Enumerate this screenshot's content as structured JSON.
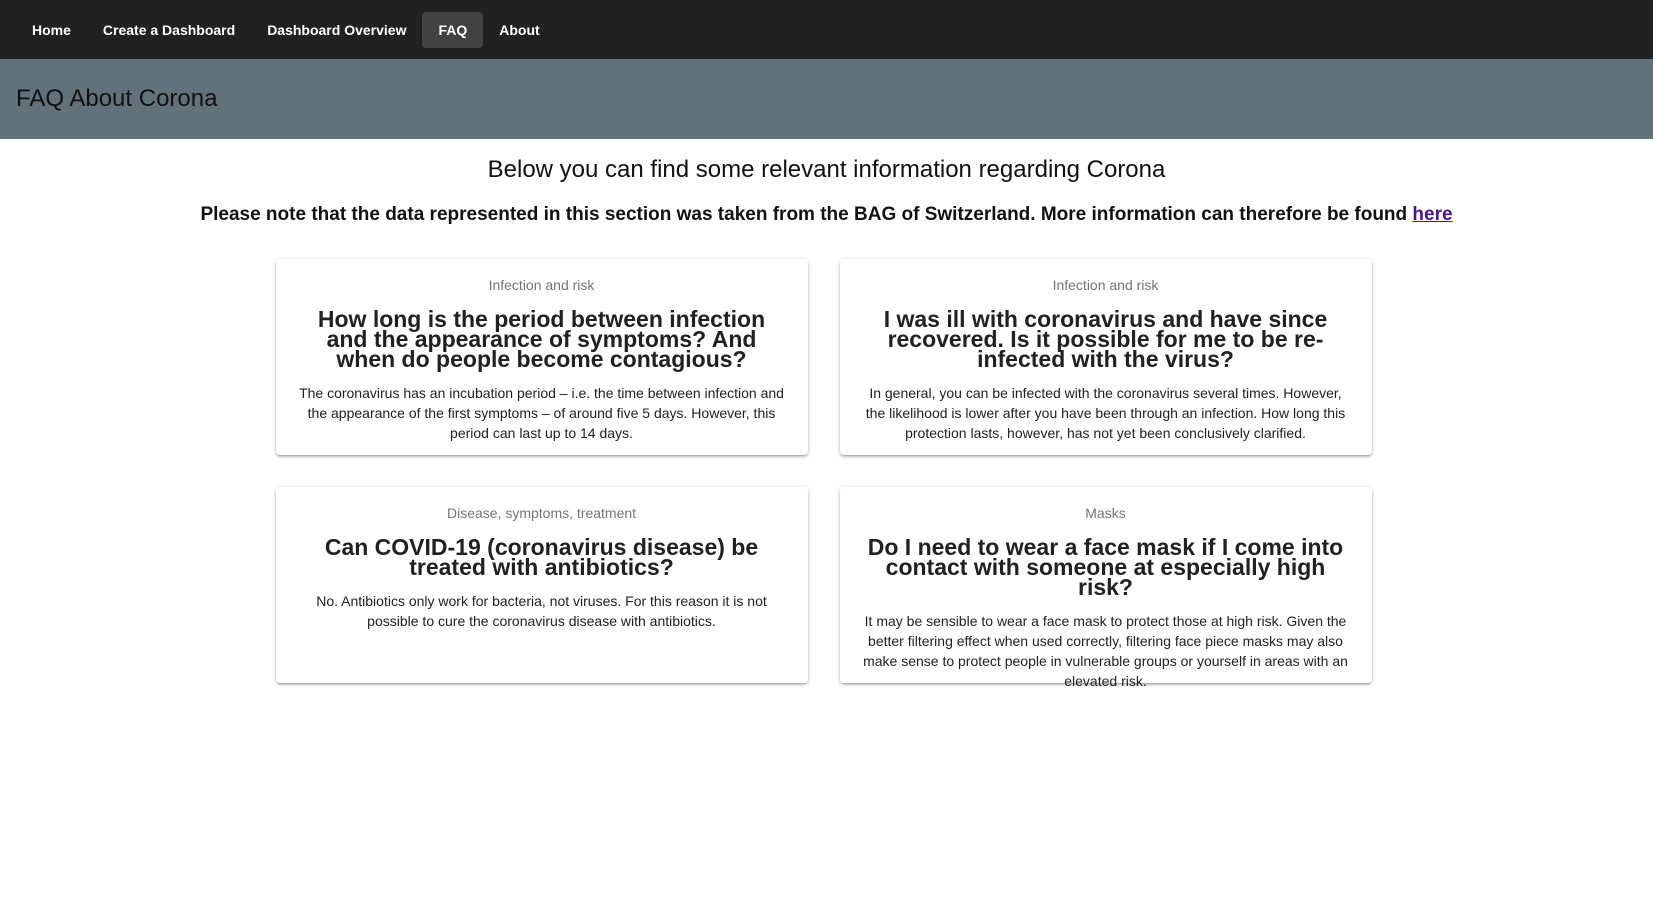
{
  "nav": {
    "items": [
      {
        "label": "Home"
      },
      {
        "label": "Create a Dashboard"
      },
      {
        "label": "Dashboard Overview"
      },
      {
        "label": "FAQ"
      },
      {
        "label": "About"
      }
    ],
    "active_index": 3
  },
  "header": {
    "title": "FAQ About Corona"
  },
  "intro": {
    "text": "Below you can find some relevant information regarding Corona",
    "note": "Please note that the data represented in this section was taken from the BAG of Switzerland. More information can therefore be found ",
    "link_label": "here"
  },
  "faq": [
    {
      "category": "Infection and risk",
      "question": "How long is the period between infection and the appearance of symptoms? And when do people become contagious?",
      "answer": "The coronavirus has an incubation period – i.e. the time between infection and the appearance of the first symptoms – of around five 5 days. However, this period can last up to 14 days."
    },
    {
      "category": "Infection and risk",
      "question": "I was ill with coronavirus and have since recovered. Is it possible for me to be re-infected with the virus?",
      "answer": "In general, you can be infected with the coronavirus several times. However, the likelihood is lower after you have been through an infection. How long this protection lasts, however, has not yet been conclusively clarified."
    },
    {
      "category": "Disease, symptoms, treatment",
      "question": "Can COVID-19 (coronavirus disease) be treated with antibiotics?",
      "answer": "No. Antibiotics only work for bacteria, not viruses. For this reason it is not possible to cure the coronavirus disease with antibiotics."
    },
    {
      "category": "Masks",
      "question": "Do I need to wear a face mask if I come into contact with someone at especially high risk?",
      "answer": "It may be sensible to wear a face mask to protect those at high risk. Given the better filtering effect when used correctly, filtering face piece masks may also make sense to protect people in vulnerable groups or yourself in areas with an elevated risk."
    }
  ],
  "colors": {
    "navbar": "#212121",
    "nav_active": "#424242",
    "header": "#62727b",
    "link": "#4a148c"
  }
}
